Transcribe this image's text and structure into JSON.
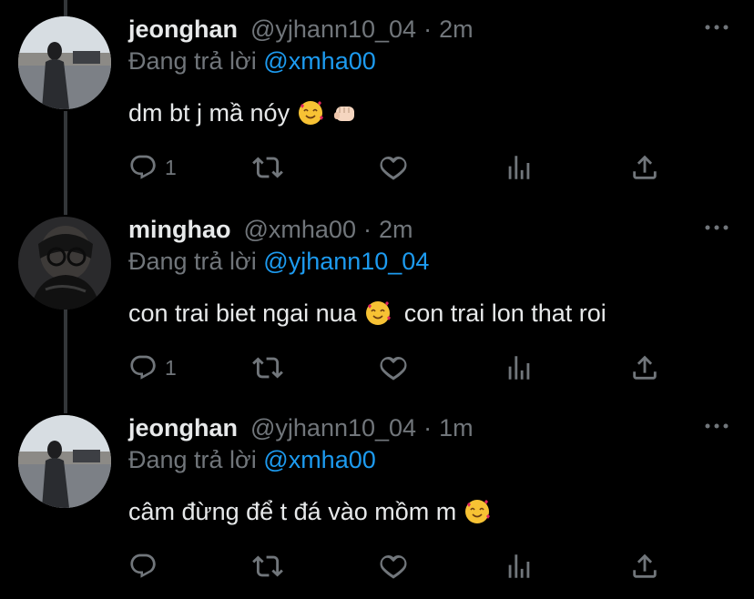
{
  "tweets": [
    {
      "display_name": "jeonghan",
      "handle": "@yjhann10_04",
      "separator": "·",
      "time": "2m",
      "reply_prefix": "Đang trả lời",
      "reply_to": "@xmha00",
      "text": "dm bt j mầ nóy",
      "text_suffix": "",
      "emojis": [
        "smiling-face-with-hearts-emoji",
        "fist-emoji"
      ],
      "reply_count": "1"
    },
    {
      "display_name": "minghao",
      "handle": "@xmha00",
      "separator": "·",
      "time": "2m",
      "reply_prefix": "Đang trả lời",
      "reply_to": "@yjhann10_04",
      "text": "con trai biet ngai nua",
      "text_suffix": "con trai lon that roi",
      "emojis": [
        "smiling-face-with-hearts-emoji"
      ],
      "reply_count": "1"
    },
    {
      "display_name": "jeonghan",
      "handle": "@yjhann10_04",
      "separator": "·",
      "time": "1m",
      "reply_prefix": "Đang trả lời",
      "reply_to": "@xmha00",
      "text": "câm đừng để t đá vào mồm m",
      "text_suffix": "",
      "emojis": [
        "smiling-face-with-hearts-emoji"
      ],
      "reply_count": ""
    }
  ],
  "icons": {
    "reply": "reply-icon",
    "retweet": "retweet-icon",
    "like": "heart-icon",
    "views": "views-icon",
    "share": "share-icon",
    "more": "more-icon"
  },
  "colors": {
    "background": "#000000",
    "text": "#e7e9ea",
    "secondary": "#71767b",
    "mention": "#1d9bf0",
    "thread_line": "#333639"
  }
}
